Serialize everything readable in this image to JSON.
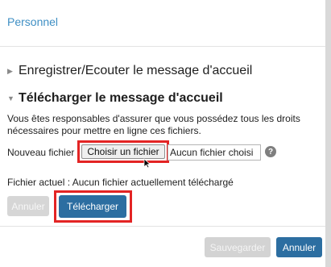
{
  "dialog": {
    "title": "Personnel"
  },
  "sections": {
    "record": {
      "label": "Enregistrer/Ecouter le message d'accueil"
    },
    "upload": {
      "label": "Télécharger le message d'accueil"
    }
  },
  "upload_form": {
    "description": "Vous êtes responsables d'assurer que vous possédez tous les droits nécessaires pour mettre en ligne ces fichiers.",
    "new_file_label": "Nouveau fichier :",
    "choose_button": "Choisir un fichier",
    "no_file_text": "Aucun fichier choisi",
    "help_glyph": "?",
    "current_file": "Fichier actuel : Aucun fichier actuellement téléchargé",
    "cancel_label": "Annuler",
    "upload_label": "Télécharger"
  },
  "footer": {
    "save_label": "Sauvegarder",
    "cancel_label": "Annuler"
  },
  "colors": {
    "title": "#3f8fc4",
    "primary": "#2c6ea1",
    "highlight": "#e32424",
    "disabled": "#d6d6d6"
  },
  "icons": {
    "collapsed": "triangle-right-icon",
    "expanded": "triangle-down-icon",
    "help": "help-icon",
    "cursor": "mouse-cursor-icon"
  }
}
